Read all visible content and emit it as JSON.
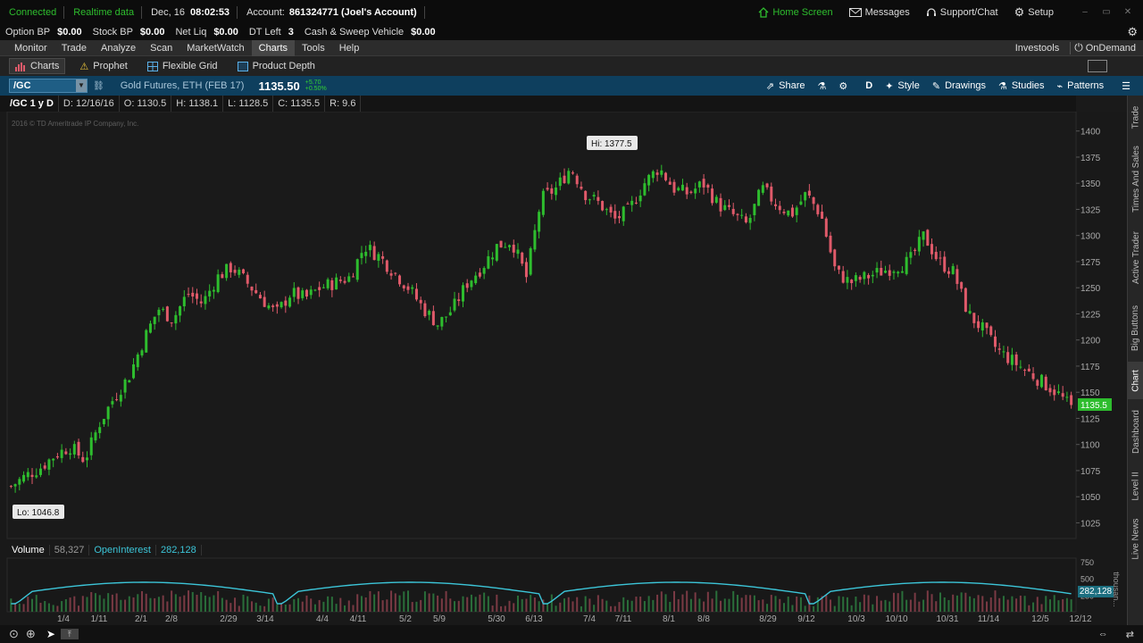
{
  "status": {
    "connected": "Connected",
    "realtime": "Realtime data",
    "date": "Dec, 16",
    "time": "08:02:53",
    "account_label": "Account:",
    "account": "861324771 (Joel's Account)",
    "home_screen": "Home Screen",
    "messages": "Messages",
    "support": "Support/Chat",
    "setup": "Setup"
  },
  "account_bar": [
    {
      "label": "Option BP",
      "value": "$0.00"
    },
    {
      "label": "Stock BP",
      "value": "$0.00"
    },
    {
      "label": "Net Liq",
      "value": "$0.00"
    },
    {
      "label": "DT Left",
      "value": "3"
    },
    {
      "label": "Cash & Sweep Vehicle",
      "value": "$0.00"
    }
  ],
  "menu": [
    "Monitor",
    "Trade",
    "Analyze",
    "Scan",
    "MarketWatch",
    "Charts",
    "Tools",
    "Help"
  ],
  "menu_right": {
    "investools": "Investools",
    "ondemand": "OnDemand"
  },
  "subtabs": [
    "Charts",
    "Prophet",
    "Flexible Grid",
    "Product Depth"
  ],
  "symbol_bar": {
    "symbol": "/GC",
    "description": "Gold Futures, ETH (FEB 17)",
    "price": "1135.50",
    "change": "+5.70",
    "change_pct": "+0.50%",
    "share": "Share",
    "aggregation": "D",
    "style": "Style",
    "drawings": "Drawings",
    "studies": "Studies",
    "patterns": "Patterns"
  },
  "ohlc": {
    "label": "/GC 1 y D",
    "date": "D: 12/16/16",
    "open": "O: 1130.5",
    "high": "H: 1138.1",
    "low": "L: 1128.5",
    "close": "C: 1135.5",
    "range": "R: 9.6"
  },
  "copyright": "2016 © TD Ameritrade IP Company, Inc.",
  "hi_label": "Hi: 1377.5",
  "lo_label": "Lo: 1046.8",
  "last_price_tag": "1135.5",
  "volume_pane": {
    "volume_label": "Volume",
    "volume_value": "58,327",
    "oi_label": "OpenInterest",
    "oi_value": "282,128",
    "oi_tag": "282,128",
    "unit": "thousan..."
  },
  "right_tabs": [
    "Trade",
    "Times And Sales",
    "Active Trader",
    "Big Buttons",
    "Chart",
    "Dashboard",
    "Level II",
    "Live News"
  ],
  "colors": {
    "up": "#2ebd2e",
    "down": "#e05a6a",
    "oi_line": "#3cc5d8",
    "accent": "#2ebd2e"
  },
  "icons": [
    "home-icon",
    "messages-icon",
    "headset-icon",
    "gear-icon",
    "chart-icon",
    "warning-icon",
    "grid-icon",
    "depth-icon",
    "share-icon",
    "flask-icon",
    "style-icon",
    "pencil-icon",
    "studies-icon",
    "patterns-icon",
    "zoom-icon"
  ],
  "chart_data": {
    "type": "candlestick",
    "title": "/GC 1 y D",
    "ylim": [
      1010,
      1410
    ],
    "y_ticks": [
      1025,
      1050,
      1075,
      1100,
      1125,
      1150,
      1175,
      1200,
      1225,
      1250,
      1275,
      1300,
      1325,
      1350,
      1375,
      1400
    ],
    "x_ticks": [
      "1/4",
      "1/11",
      "2/1",
      "2/8",
      "2/29",
      "3/14",
      "4/4",
      "4/11",
      "5/2",
      "5/9",
      "5/30",
      "6/13",
      "7/4",
      "7/11",
      "8/1",
      "8/8",
      "8/29",
      "9/12",
      "10/3",
      "10/10",
      "10/31",
      "11/14",
      "12/5",
      "12/12"
    ],
    "close_path": [
      1060,
      1070,
      1078,
      1090,
      1098,
      1085,
      1120,
      1145,
      1165,
      1200,
      1230,
      1220,
      1245,
      1235,
      1260,
      1270,
      1255,
      1240,
      1225,
      1245,
      1240,
      1250,
      1255,
      1260,
      1290,
      1280,
      1265,
      1250,
      1230,
      1215,
      1230,
      1255,
      1270,
      1290,
      1295,
      1260,
      1335,
      1345,
      1365,
      1340,
      1330,
      1315,
      1325,
      1350,
      1365,
      1345,
      1340,
      1350,
      1330,
      1320,
      1310,
      1345,
      1330,
      1320,
      1340,
      1320,
      1265,
      1255,
      1260,
      1265,
      1270,
      1275,
      1300,
      1275,
      1265,
      1225,
      1210,
      1190,
      1180,
      1170,
      1160,
      1150,
      1135
    ],
    "volume_axis": [
      250,
      500,
      750
    ],
    "volume_unit": "thousands"
  }
}
